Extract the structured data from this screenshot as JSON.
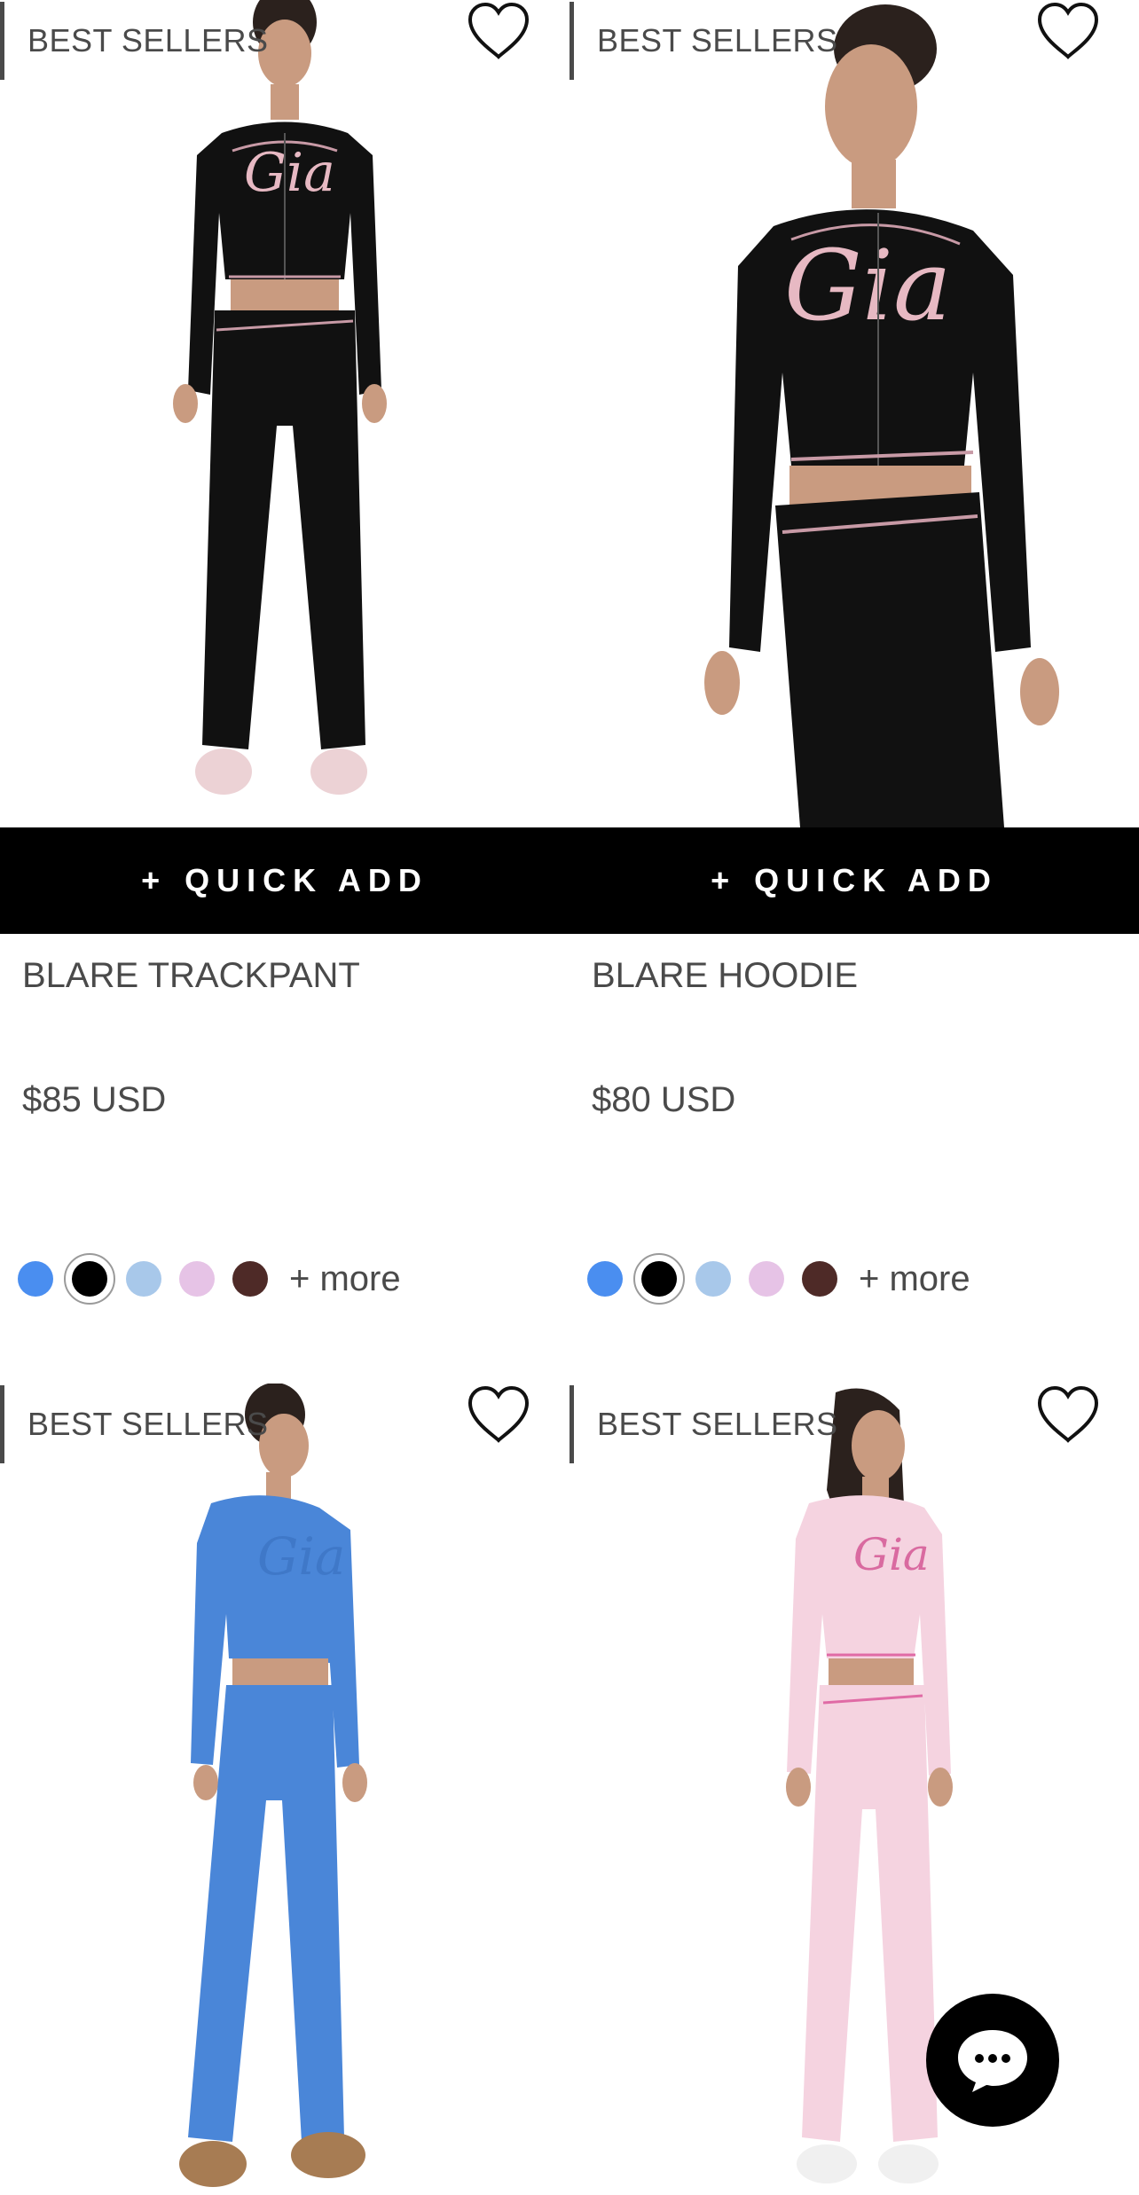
{
  "colors": {
    "text": "#4a4a4a",
    "quick_add_bg": "#000000",
    "swatch_blue": "#4a8ef0",
    "swatch_black": "#000000",
    "swatch_light_blue": "#a8c8ea",
    "swatch_pink": "#e6c3e6",
    "swatch_brown": "#4e2a27",
    "chat_bg": "#000000"
  },
  "products": [
    {
      "badge": "BEST SELLERS",
      "quick_add": "QUICK ADD",
      "quick_add_plus": "+",
      "title": "BLARE TRACKPANT",
      "price": "$85 USD",
      "more": "+ more",
      "image": "black-tracksuit-front-full",
      "swatches": [
        "blue",
        "black",
        "light-blue",
        "pink",
        "brown"
      ],
      "selected_swatch": "black"
    },
    {
      "badge": "BEST SELLERS",
      "quick_add": "QUICK ADD",
      "quick_add_plus": "+",
      "title": "BLARE HOODIE",
      "price": "$80 USD",
      "more": "+ more",
      "image": "black-hoodie-closeup",
      "swatches": [
        "blue",
        "black",
        "light-blue",
        "pink",
        "brown"
      ],
      "selected_swatch": "black"
    },
    {
      "badge": "BEST SELLERS",
      "image": "blue-tracksuit-side"
    },
    {
      "badge": "BEST SELLERS",
      "image": "pink-tracksuit-front"
    }
  ],
  "icons": {
    "heart": "heart-outline-icon",
    "chat": "chat-bubble-icon"
  }
}
